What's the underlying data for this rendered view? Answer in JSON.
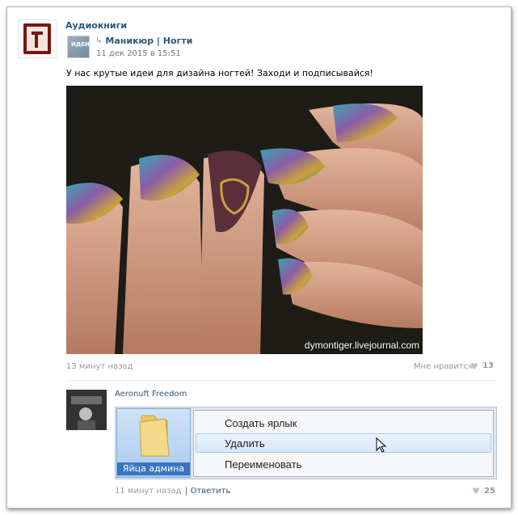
{
  "group": {
    "name": "Аудиокниги",
    "avatar_icon": "book-icon"
  },
  "repost": {
    "icon": "repost-arrow-icon",
    "source_name": "Маникюр | Ногти",
    "source_thumb_text": "ИДЕИ",
    "date": "11 дек 2015 в 15:51"
  },
  "post": {
    "text": "У нас крутые идеи для дизайна ногтей! Заходи и подписывайся!",
    "photo_watermark": "dymontiger.livejournal.com",
    "time_ago": "13 минут назад",
    "like_label": "Мне нравится",
    "like_count": "13"
  },
  "comment": {
    "author": "Aeronuft Freedom",
    "screenshot": {
      "folder_label": "Яйца админа",
      "menu_items": [
        "Создать ярлык",
        "Удалить",
        "Переименовать"
      ],
      "highlighted_index": 1
    },
    "time_ago": "11 минут назад",
    "reply_label": "Ответить",
    "like_count": "25"
  },
  "colors": {
    "link": "#2b587a",
    "muted": "#999999",
    "like": "#8a9aab"
  }
}
